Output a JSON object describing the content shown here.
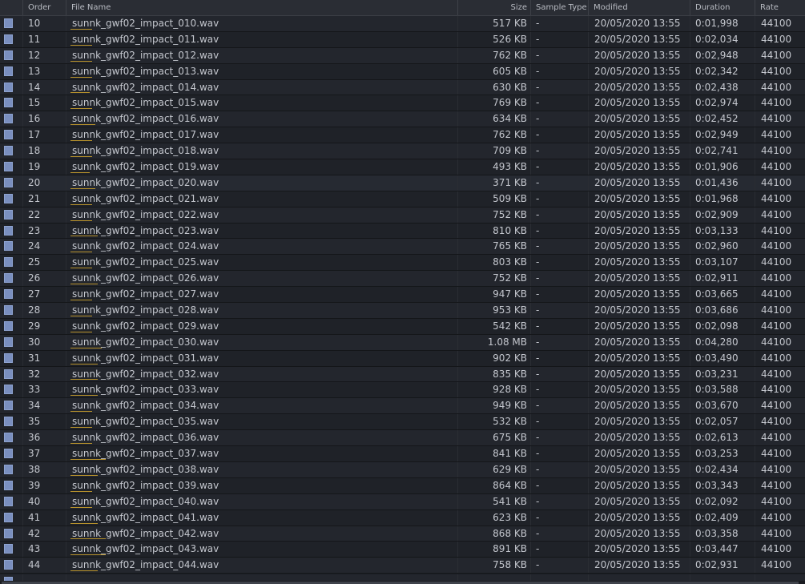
{
  "columns": {
    "order": "Order",
    "file_name": "File Name",
    "size": "Size",
    "sample_type": "Sample Type",
    "modified": "Modified",
    "duration": "Duration",
    "rate": "Rate"
  },
  "rows": [
    {
      "order": "10",
      "name": "sunnk_gwf02_impact_010.wav",
      "size": "517 KB",
      "type": "-",
      "modified": "20/05/2020 13:55",
      "duration": "0:01,998",
      "rate": "44100"
    },
    {
      "order": "11",
      "name": "sunnk_gwf02_impact_011.wav",
      "size": "526 KB",
      "type": "-",
      "modified": "20/05/2020 13:55",
      "duration": "0:02,034",
      "rate": "44100"
    },
    {
      "order": "12",
      "name": "sunnk_gwf02_impact_012.wav",
      "size": "762 KB",
      "type": "-",
      "modified": "20/05/2020 13:55",
      "duration": "0:02,948",
      "rate": "44100"
    },
    {
      "order": "13",
      "name": "sunnk_gwf02_impact_013.wav",
      "size": "605 KB",
      "type": "-",
      "modified": "20/05/2020 13:55",
      "duration": "0:02,342",
      "rate": "44100"
    },
    {
      "order": "14",
      "name": "sunnk_gwf02_impact_014.wav",
      "size": "630 KB",
      "type": "-",
      "modified": "20/05/2020 13:55",
      "duration": "0:02,438",
      "rate": "44100"
    },
    {
      "order": "15",
      "name": "sunnk_gwf02_impact_015.wav",
      "size": "769 KB",
      "type": "-",
      "modified": "20/05/2020 13:55",
      "duration": "0:02,974",
      "rate": "44100"
    },
    {
      "order": "16",
      "name": "sunnk_gwf02_impact_016.wav",
      "size": "634 KB",
      "type": "-",
      "modified": "20/05/2020 13:55",
      "duration": "0:02,452",
      "rate": "44100"
    },
    {
      "order": "17",
      "name": "sunnk_gwf02_impact_017.wav",
      "size": "762 KB",
      "type": "-",
      "modified": "20/05/2020 13:55",
      "duration": "0:02,949",
      "rate": "44100"
    },
    {
      "order": "18",
      "name": "sunnk_gwf02_impact_018.wav",
      "size": "709 KB",
      "type": "-",
      "modified": "20/05/2020 13:55",
      "duration": "0:02,741",
      "rate": "44100"
    },
    {
      "order": "19",
      "name": "sunnk_gwf02_impact_019.wav",
      "size": "493 KB",
      "type": "-",
      "modified": "20/05/2020 13:55",
      "duration": "0:01,906",
      "rate": "44100"
    },
    {
      "order": "20",
      "name": "sunnk_gwf02_impact_020.wav",
      "size": "371 KB",
      "type": "-",
      "modified": "20/05/2020 13:55",
      "duration": "0:01,436",
      "rate": "44100"
    },
    {
      "order": "21",
      "name": "sunnk_gwf02_impact_021.wav",
      "size": "509 KB",
      "type": "-",
      "modified": "20/05/2020 13:55",
      "duration": "0:01,968",
      "rate": "44100"
    },
    {
      "order": "22",
      "name": "sunnk_gwf02_impact_022.wav",
      "size": "752 KB",
      "type": "-",
      "modified": "20/05/2020 13:55",
      "duration": "0:02,909",
      "rate": "44100"
    },
    {
      "order": "23",
      "name": "sunnk_gwf02_impact_023.wav",
      "size": "810 KB",
      "type": "-",
      "modified": "20/05/2020 13:55",
      "duration": "0:03,133",
      "rate": "44100"
    },
    {
      "order": "24",
      "name": "sunnk_gwf02_impact_024.wav",
      "size": "765 KB",
      "type": "-",
      "modified": "20/05/2020 13:55",
      "duration": "0:02,960",
      "rate": "44100"
    },
    {
      "order": "25",
      "name": "sunnk_gwf02_impact_025.wav",
      "size": "803 KB",
      "type": "-",
      "modified": "20/05/2020 13:55",
      "duration": "0:03,107",
      "rate": "44100"
    },
    {
      "order": "26",
      "name": "sunnk_gwf02_impact_026.wav",
      "size": "752 KB",
      "type": "-",
      "modified": "20/05/2020 13:55",
      "duration": "0:02,911",
      "rate": "44100"
    },
    {
      "order": "27",
      "name": "sunnk_gwf02_impact_027.wav",
      "size": "947 KB",
      "type": "-",
      "modified": "20/05/2020 13:55",
      "duration": "0:03,665",
      "rate": "44100"
    },
    {
      "order": "28",
      "name": "sunnk_gwf02_impact_028.wav",
      "size": "953 KB",
      "type": "-",
      "modified": "20/05/2020 13:55",
      "duration": "0:03,686",
      "rate": "44100"
    },
    {
      "order": "29",
      "name": "sunnk_gwf02_impact_029.wav",
      "size": "542 KB",
      "type": "-",
      "modified": "20/05/2020 13:55",
      "duration": "0:02,098",
      "rate": "44100"
    },
    {
      "order": "30",
      "name": "sunnk_gwf02_impact_030.wav",
      "size": "1.08 MB",
      "type": "-",
      "modified": "20/05/2020 13:55",
      "duration": "0:04,280",
      "rate": "44100"
    },
    {
      "order": "31",
      "name": "sunnk_gwf02_impact_031.wav",
      "size": "902 KB",
      "type": "-",
      "modified": "20/05/2020 13:55",
      "duration": "0:03,490",
      "rate": "44100"
    },
    {
      "order": "32",
      "name": "sunnk_gwf02_impact_032.wav",
      "size": "835 KB",
      "type": "-",
      "modified": "20/05/2020 13:55",
      "duration": "0:03,231",
      "rate": "44100"
    },
    {
      "order": "33",
      "name": "sunnk_gwf02_impact_033.wav",
      "size": "928 KB",
      "type": "-",
      "modified": "20/05/2020 13:55",
      "duration": "0:03,588",
      "rate": "44100"
    },
    {
      "order": "34",
      "name": "sunnk_gwf02_impact_034.wav",
      "size": "949 KB",
      "type": "-",
      "modified": "20/05/2020 13:55",
      "duration": "0:03,670",
      "rate": "44100"
    },
    {
      "order": "35",
      "name": "sunnk_gwf02_impact_035.wav",
      "size": "532 KB",
      "type": "-",
      "modified": "20/05/2020 13:55",
      "duration": "0:02,057",
      "rate": "44100"
    },
    {
      "order": "36",
      "name": "sunnk_gwf02_impact_036.wav",
      "size": "675 KB",
      "type": "-",
      "modified": "20/05/2020 13:55",
      "duration": "0:02,613",
      "rate": "44100"
    },
    {
      "order": "37",
      "name": "sunnk_gwf02_impact_037.wav",
      "size": "841 KB",
      "type": "-",
      "modified": "20/05/2020 13:55",
      "duration": "0:03,253",
      "rate": "44100"
    },
    {
      "order": "38",
      "name": "sunnk_gwf02_impact_038.wav",
      "size": "629 KB",
      "type": "-",
      "modified": "20/05/2020 13:55",
      "duration": "0:02,434",
      "rate": "44100"
    },
    {
      "order": "39",
      "name": "sunnk_gwf02_impact_039.wav",
      "size": "864 KB",
      "type": "-",
      "modified": "20/05/2020 13:55",
      "duration": "0:03,343",
      "rate": "44100"
    },
    {
      "order": "40",
      "name": "sunnk_gwf02_impact_040.wav",
      "size": "541 KB",
      "type": "-",
      "modified": "20/05/2020 13:55",
      "duration": "0:02,092",
      "rate": "44100"
    },
    {
      "order": "41",
      "name": "sunnk_gwf02_impact_041.wav",
      "size": "623 KB",
      "type": "-",
      "modified": "20/05/2020 13:55",
      "duration": "0:02,409",
      "rate": "44100"
    },
    {
      "order": "42",
      "name": "sunnk_gwf02_impact_042.wav",
      "size": "868 KB",
      "type": "-",
      "modified": "20/05/2020 13:55",
      "duration": "0:03,358",
      "rate": "44100"
    },
    {
      "order": "43",
      "name": "sunnk_gwf02_impact_043.wav",
      "size": "891 KB",
      "type": "-",
      "modified": "20/05/2020 13:55",
      "duration": "0:03,447",
      "rate": "44100"
    },
    {
      "order": "44",
      "name": "sunnk_gwf02_impact_044.wav",
      "size": "758 KB",
      "type": "-",
      "modified": "20/05/2020 13:55",
      "duration": "0:02,931",
      "rate": "44100"
    }
  ],
  "colors": {
    "checkbox": "#7a8fbf",
    "name_underline": "#b7922c",
    "background": "#1c1f26"
  }
}
